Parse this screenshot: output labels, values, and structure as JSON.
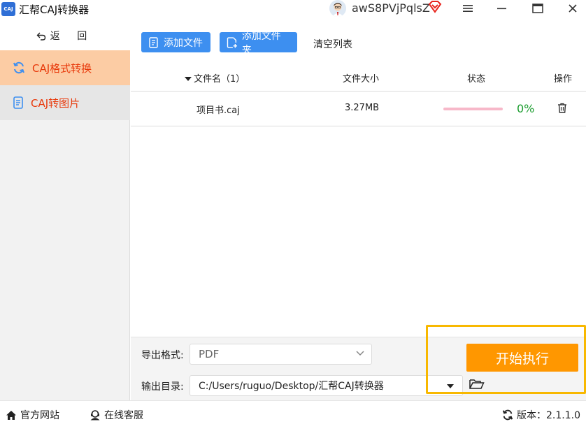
{
  "window": {
    "logo_text": "CAJ",
    "title": "汇帮CAJ转换器",
    "username": "awS8PVjPqlsZ"
  },
  "sidebar": {
    "back_label": "返 回",
    "items": [
      {
        "label": "CAJ格式转换",
        "icon": "refresh-icon",
        "active": true
      },
      {
        "label": "CAJ转图片",
        "icon": "document-icon",
        "active": false
      }
    ]
  },
  "toolbar": {
    "add_file": "添加文件",
    "add_folder": "添加文件夹",
    "clear_list": "清空列表"
  },
  "table": {
    "headers": {
      "name": "文件名（1）",
      "size": "文件大小",
      "status": "状态",
      "action": "操作"
    },
    "rows": [
      {
        "name": "项目书.caj",
        "size": "3.27MB",
        "progress": 0,
        "progress_text": "0%"
      }
    ]
  },
  "output": {
    "format_label": "导出格式:",
    "format_value": "PDF",
    "dir_label": "输出目录:",
    "dir_value": "C:/Users/ruguo/Desktop/汇帮CAJ转换器",
    "start_button": "开始执行"
  },
  "statusbar": {
    "official_site": "官方网站",
    "online_service": "在线客服",
    "version": "版本：2.1.1.0"
  },
  "colors": {
    "accent_orange": "#ff9700",
    "button_blue": "#3d8ff0",
    "active_nav_bg": "#fccca4",
    "nav_text": "#e8390b",
    "highlight_border": "#f8b800",
    "progress_pink": "#f7b8c9",
    "percent_green": "#1a9c2e"
  }
}
